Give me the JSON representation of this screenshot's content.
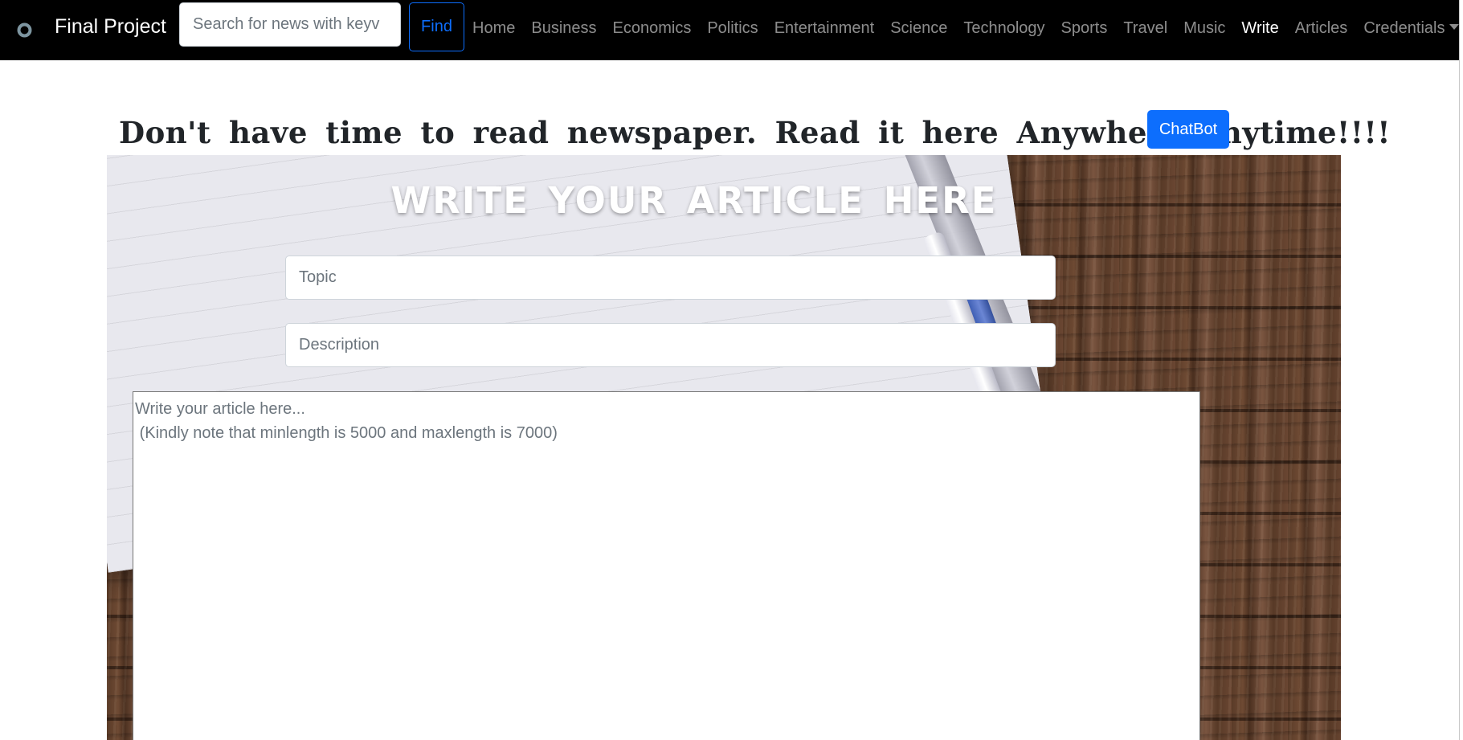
{
  "navbar": {
    "brand": "Final Project",
    "brand_icon": "circle-logo-icon",
    "search": {
      "placeholder": "Search for news with keyv",
      "value": ""
    },
    "find_label": "Find",
    "links": [
      {
        "label": "Home",
        "active": false
      },
      {
        "label": "Business",
        "active": false
      },
      {
        "label": "Economics",
        "active": false
      },
      {
        "label": "Politics",
        "active": false
      },
      {
        "label": "Entertainment",
        "active": false
      },
      {
        "label": "Science",
        "active": false
      },
      {
        "label": "Technology",
        "active": false
      },
      {
        "label": "Sports",
        "active": false
      },
      {
        "label": "Travel",
        "active": false
      },
      {
        "label": "Music",
        "active": false
      },
      {
        "label": "Write",
        "active": true
      },
      {
        "label": "Articles",
        "active": false
      }
    ],
    "dropdown_label": "Credentials"
  },
  "header": {
    "tagline": "Don't have time to read newspaper. Read it here Anywhere anytime!!!!",
    "chatbot_label": "ChatBot"
  },
  "form": {
    "title": "WRITE YOUR ARTICLE HERE",
    "topic": {
      "placeholder": "Topic",
      "value": ""
    },
    "description": {
      "placeholder": "Description",
      "value": ""
    },
    "article": {
      "placeholder": "Write your article here...\n (Kindly note that minlength is 5000 and maxlength is 7000)",
      "value": ""
    }
  },
  "colors": {
    "navbar_bg": "#000000",
    "primary": "#0d6efd",
    "nav_link": "rgba(255,255,255,0.55)",
    "nav_link_active": "#ffffff",
    "heading_text": "#212529"
  }
}
